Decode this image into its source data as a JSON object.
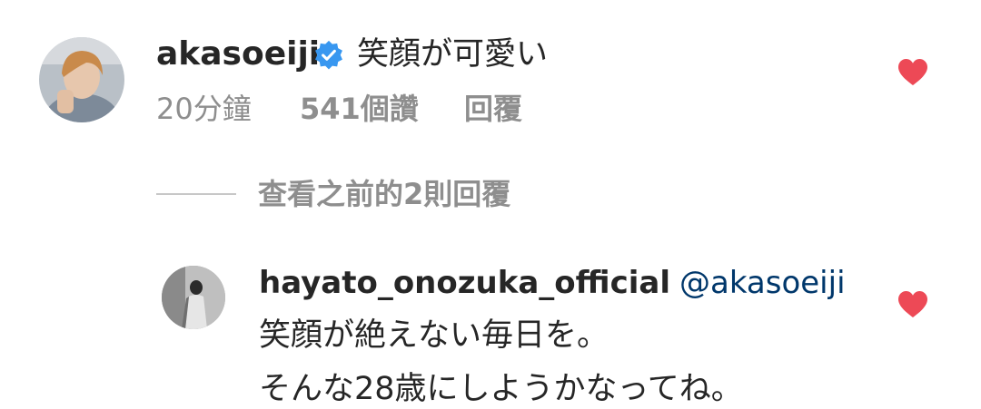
{
  "comment": {
    "username": "akasoeiji",
    "verified": true,
    "text": "笑顔が可愛い",
    "time": "20分鐘",
    "likes": "541個讚",
    "reply_label": "回覆",
    "liked": true
  },
  "view_previous": "查看之前的2則回覆",
  "reply": {
    "username": "hayato_onozuka_official",
    "mention": "@akasoeiji",
    "lines": [
      "笑顔が絶えない毎日を。",
      "そんな28歳にしようかなってね。"
    ],
    "liked": true
  },
  "colors": {
    "heart": "#ed4956",
    "verified": "#3897f0",
    "mention": "#00376b",
    "secondary_text": "#8e8e8e"
  },
  "icons": {
    "verified": "verified-badge-icon",
    "like": "heart-icon"
  }
}
